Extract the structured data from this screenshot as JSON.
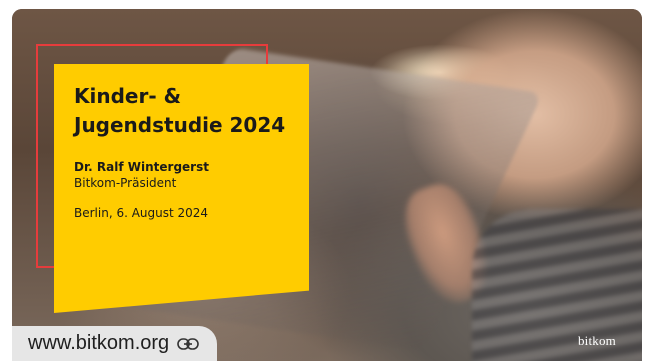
{
  "slide": {
    "title_line1": "Kinder- &",
    "title_line2": "Jugendstudie 2024",
    "author": "Dr. Ralf Wintergerst",
    "role": "Bitkom-Präsident",
    "place_date": "Berlin, 6. August 2024",
    "brand": "bitkom"
  },
  "link": {
    "url": "www.bitkom.org",
    "icon": "link-icon"
  },
  "colors": {
    "accent_yellow": "#ffcc00",
    "frame_red": "#e63c3c",
    "pill_bg": "#e6e6e6"
  }
}
